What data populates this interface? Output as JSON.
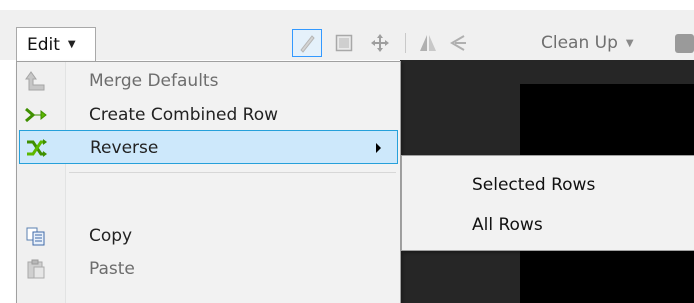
{
  "toolbar": {
    "edit_label": "Edit",
    "cleanup_label": "Clean Up",
    "tools": [
      "pencil-icon",
      "select-rectangle-icon",
      "move-icon",
      "flip-icon",
      "arrow-icon"
    ],
    "highlight_color": "#3399ff"
  },
  "menu": {
    "items": [
      {
        "label": "Merge Defaults",
        "icon": "merge-defaults-icon",
        "enabled": false
      },
      {
        "label": "Create Combined Row",
        "icon": "create-combined-row-icon",
        "enabled": true
      },
      {
        "label": "Reverse",
        "icon": "reverse-icon",
        "enabled": true,
        "highlighted": true,
        "has_submenu": true
      },
      {
        "label": "Copy",
        "icon": "copy-icon",
        "enabled": true
      },
      {
        "label": "Paste",
        "icon": "paste-icon",
        "enabled": false
      }
    ],
    "highlight_color": "#cde8fb",
    "highlight_border": "#26a0da"
  },
  "submenu": {
    "items": [
      {
        "label": "Selected Rows"
      },
      {
        "label": "All Rows"
      }
    ]
  }
}
